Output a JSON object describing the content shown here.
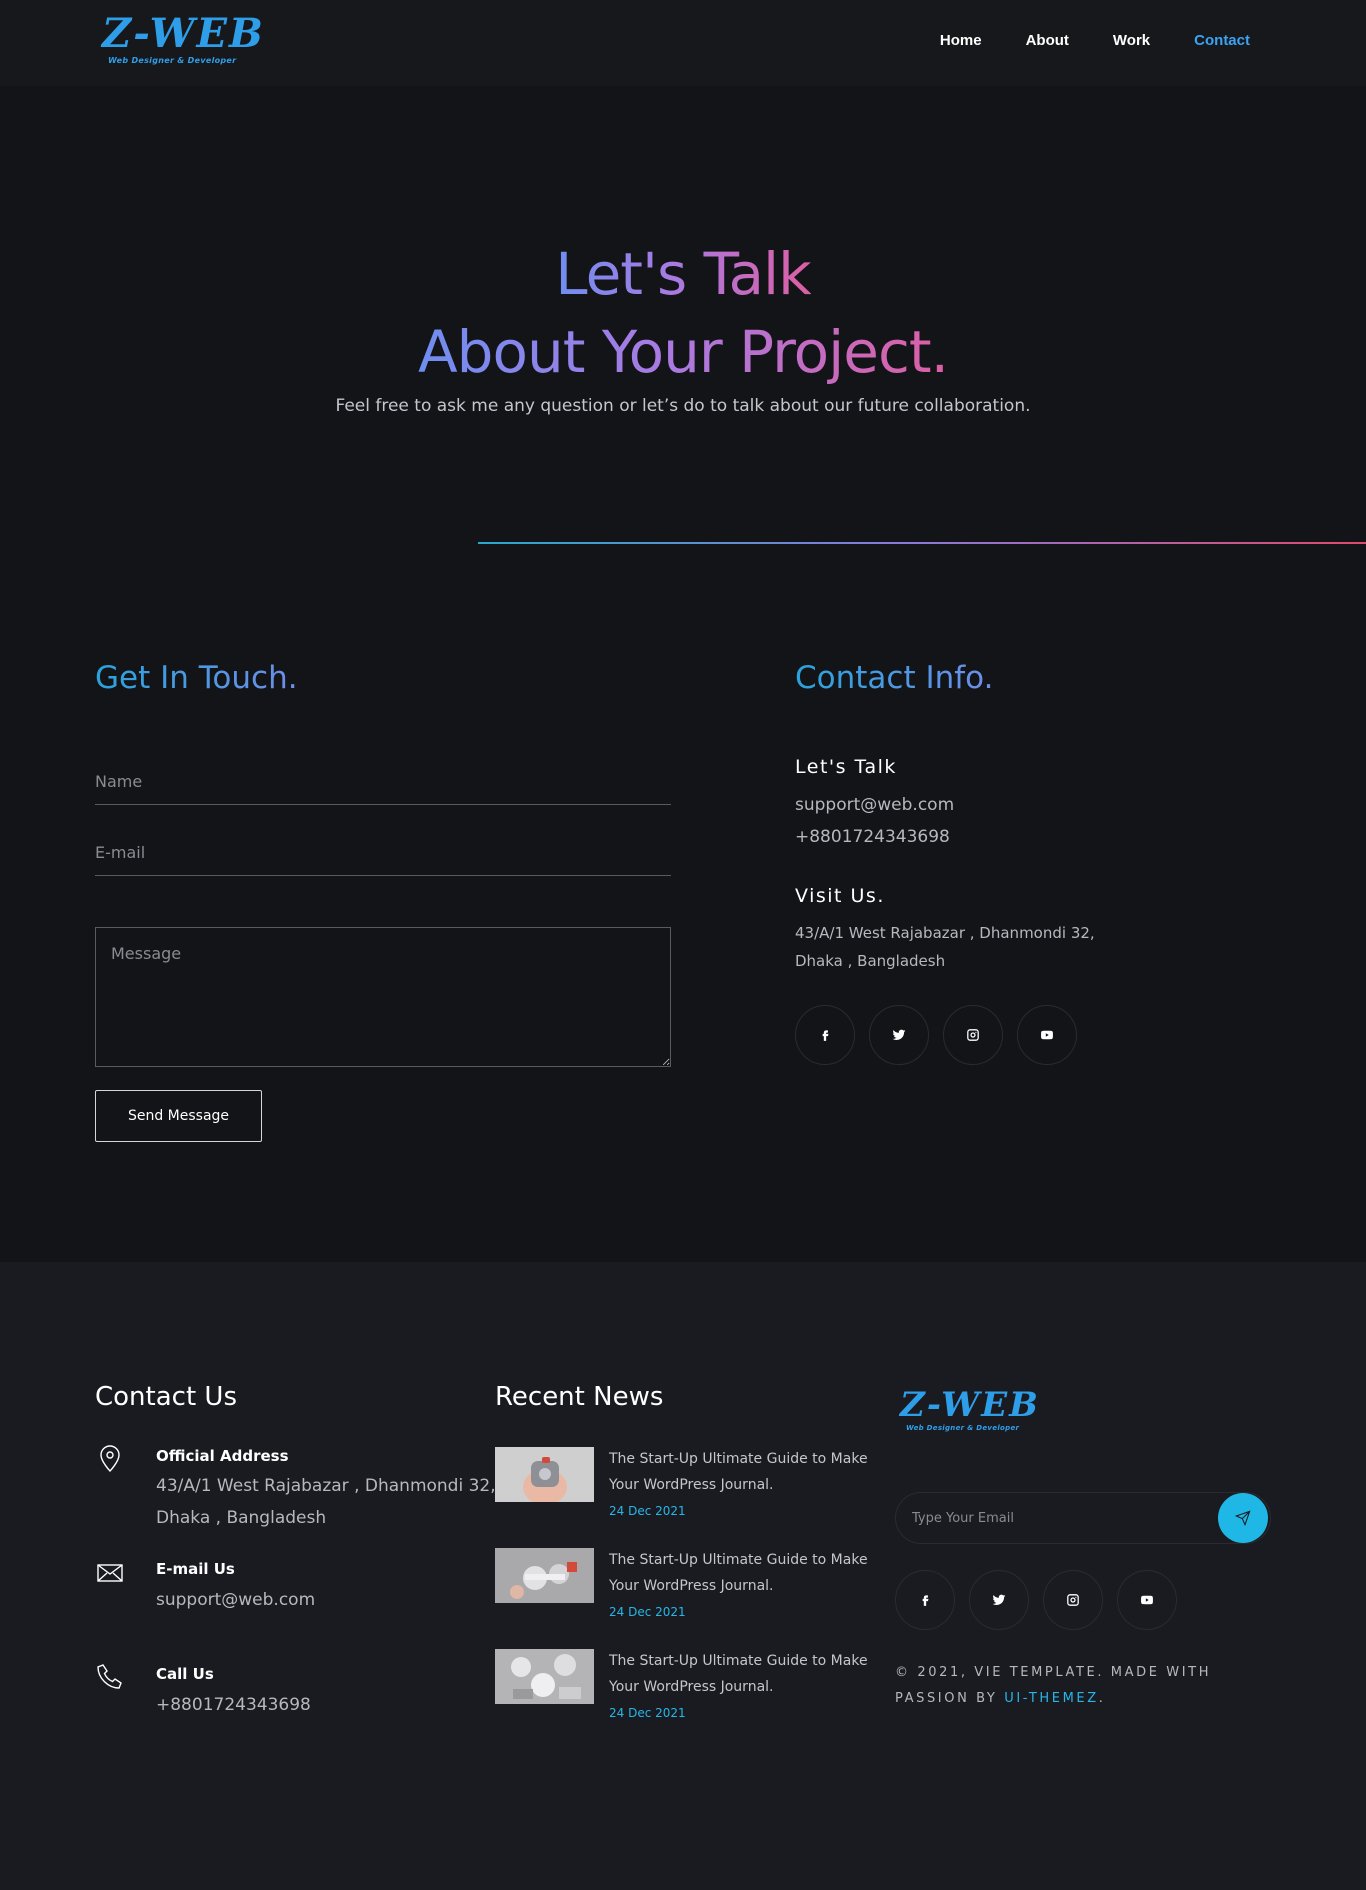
{
  "nav": {
    "logo": "Z-WEB",
    "tagline": "Web Designer & Developer",
    "links": [
      "Home",
      "About",
      "Work",
      "Contact"
    ],
    "active": "Contact"
  },
  "hero": {
    "line1": "Let's Talk",
    "line2": "About Your Project.",
    "subtitle": "Feel free to ask me any question or let’s do to talk about our future collaboration."
  },
  "form": {
    "title": "Get In Touch.",
    "name_placeholder": "Name",
    "email_placeholder": "E-mail",
    "message_placeholder": "Message",
    "send_label": "Send Message"
  },
  "info": {
    "title": "Contact Info.",
    "talk_heading": "Let's Talk",
    "email": "support@web.com",
    "phone": "+8801724343698",
    "visit_heading": "Visit Us.",
    "address_line1": "43/A/1 West Rajabazar , Dhanmondi 32,",
    "address_line2": "Dhaka , Bangladesh",
    "socials": [
      "facebook-icon",
      "twitter-icon",
      "instagram-icon",
      "youtube-icon"
    ]
  },
  "footer": {
    "contact_title": "Contact Us",
    "address_label": "Official Address",
    "address_line1": "43/A/1 West Rajabazar , Dhanmondi 32,",
    "address_line2": "Dhaka , Bangladesh",
    "email_label": "E-mail Us",
    "email": "support@web.com",
    "phone_label": "Call Us",
    "phone": "+8801724343698",
    "news_title": "Recent News",
    "news": [
      {
        "title_line1": "The Start-Up Ultimate Guide to Make",
        "title_line2": "Your WordPress Journal.",
        "date": "24 Dec 2021"
      },
      {
        "title_line1": "The Start-Up Ultimate Guide to Make",
        "title_line2": "Your WordPress Journal.",
        "date": "24 Dec 2021"
      },
      {
        "title_line1": "The Start-Up Ultimate Guide to Make",
        "title_line2": "Your WordPress Journal.",
        "date": "24 Dec 2021"
      }
    ],
    "logo": "Z-WEB",
    "tagline": "Web Designer & Developer",
    "subscribe_placeholder": "Type Your Email",
    "copyright_line1": "© 2021, VIE TEMPLATE. MADE WITH",
    "copyright_line2_prefix": "PASSION BY",
    "copyright_brand": "UI-THEMEZ",
    "copyright_suffix": "."
  },
  "colors": {
    "accent": "#27b6ea",
    "logo": "#2f9ee8",
    "background": "#131418",
    "footer_bg": "#1a1b20"
  }
}
